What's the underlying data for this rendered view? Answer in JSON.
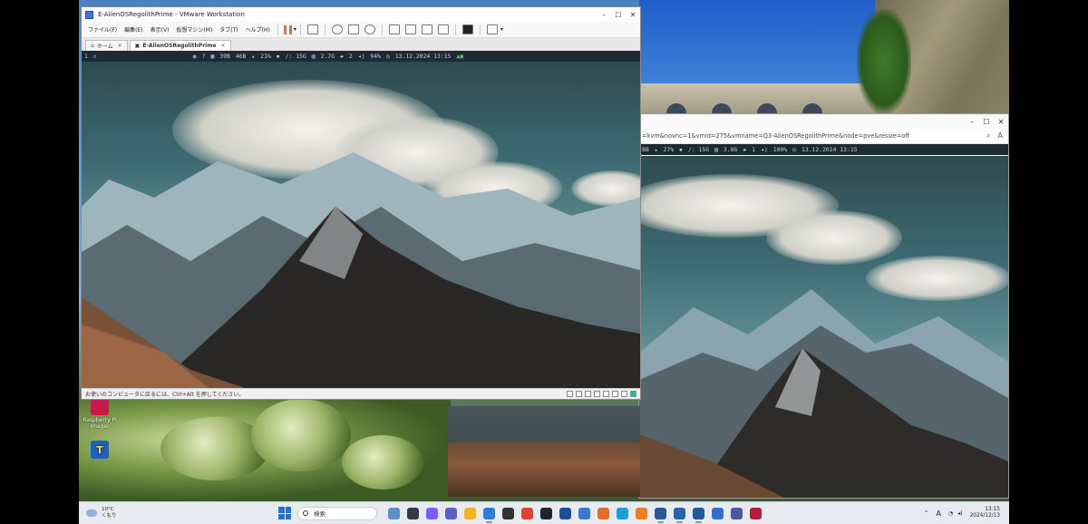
{
  "vmware": {
    "title": "E-AlienOSRegolithPrime - VMware Workstation",
    "menu": [
      "ファイル(F)",
      "編集(E)",
      "表示(V)",
      "仮想マシン(M)",
      "タブ(T)",
      "ヘルプ(H)"
    ],
    "tabs": [
      {
        "label": "ホーム"
      },
      {
        "label": "E-AlienOSRegolithPrime"
      }
    ],
    "statusbar": {
      "workspace": "1",
      "network_down": "39B",
      "network_up": "46B",
      "cpu": "21%",
      "disk": "/: 15G",
      "memory": "2.7G",
      "messages": "2",
      "volume": "94%",
      "datetime": "13.12.2024 13:15"
    },
    "bottom_hint": "お使いのコンピュータに戻るには、Ctrl+Alt を押してください。"
  },
  "browser": {
    "url": "=kvm&novnc=1&vmid=275&vmname=Q3-AlienOSRegolithPrime&node=pve&resize=off",
    "statusbar": {
      "network": "8B",
      "cpu": "27%",
      "disk": "/: 15G",
      "memory": "3.0G",
      "messages": "1",
      "volume": "100%",
      "datetime": "13.12.2024 13:15"
    }
  },
  "desktop_icons": [
    {
      "label": "Raspberry Pi Imager",
      "color": "#c51a4a"
    },
    {
      "label": "",
      "color": "#1e5fbf"
    }
  ],
  "taskbar": {
    "weather_temp": "10°C",
    "weather_desc": "くもり",
    "search_placeholder": "検索",
    "clock_time": "13:15",
    "clock_date": "2024/12/13",
    "ime": "A",
    "apps": [
      {
        "name": "landscape-app-icon",
        "color": "#5a8fc9"
      },
      {
        "name": "task-view-icon",
        "color": "#333a44"
      },
      {
        "name": "copilot-icon",
        "color": "#7a5cff"
      },
      {
        "name": "teams-icon",
        "color": "#5b5fc7"
      },
      {
        "name": "file-explorer-icon",
        "color": "#f0b429"
      },
      {
        "name": "mail-icon",
        "color": "#2b7de0"
      },
      {
        "name": "store-icon",
        "color": "#333"
      },
      {
        "name": "chrome-icon",
        "color": "#e34133"
      },
      {
        "name": "terminal-icon",
        "color": "#20252b"
      },
      {
        "name": "dev-home-icon",
        "color": "#1d4e9e"
      },
      {
        "name": "notepad-icon",
        "color": "#3a78d0"
      },
      {
        "name": "vpn-icon",
        "color": "#e86a2a"
      },
      {
        "name": "edge-icon",
        "color": "#1a9fd9"
      },
      {
        "name": "firefox-icon",
        "color": "#f07a1f"
      },
      {
        "name": "word-icon",
        "color": "#2b579a"
      },
      {
        "name": "virtualbox-icon",
        "color": "#1e67b0"
      },
      {
        "name": "vmware-icon",
        "color": "#1f5a96"
      },
      {
        "name": "remote-desktop-icon",
        "color": "#2f6fcf"
      },
      {
        "name": "network-tool-icon",
        "color": "#4a5a9a"
      },
      {
        "name": "app-red-icon",
        "color": "#b8183a"
      }
    ]
  }
}
